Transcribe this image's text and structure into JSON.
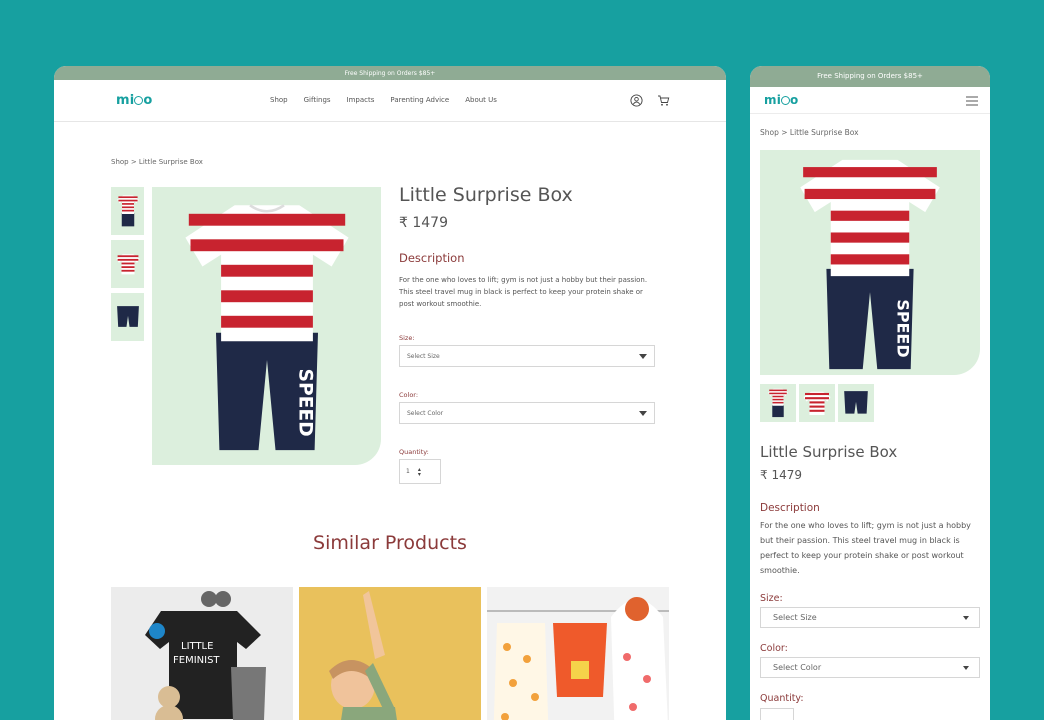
{
  "promo_text": "Free Shipping on Orders $85+",
  "brand": {
    "prefix": "mi",
    "suffix": "o",
    "color": "#17a0a0"
  },
  "nav": [
    "Shop",
    "Giftings",
    "Impacts",
    "Parenting Advice",
    "About Us"
  ],
  "header_icons": [
    "user-icon",
    "cart-icon"
  ],
  "breadcrumb": "Shop > Little Surprise Box",
  "product": {
    "title": "Little Surprise Box",
    "price": "₹ 1479",
    "description_heading": "Description",
    "description": "For the one who loves to lift; gym is not just a hobby but their passion. This steel travel mug in black is perfect to keep your protein shake or post workout smoothie.",
    "size_label": "Size:",
    "size_placeholder": "Select Size",
    "color_label": "Color:",
    "color_placeholder": "Select Color",
    "quantity_label": "Quantity:",
    "quantity_value": "1"
  },
  "similar_heading": "Similar Products",
  "colors": {
    "background": "#17a0a0",
    "promo_bar": "#8fab94",
    "accent_text": "#8b3a3a",
    "image_bg": "#dcefdd"
  }
}
